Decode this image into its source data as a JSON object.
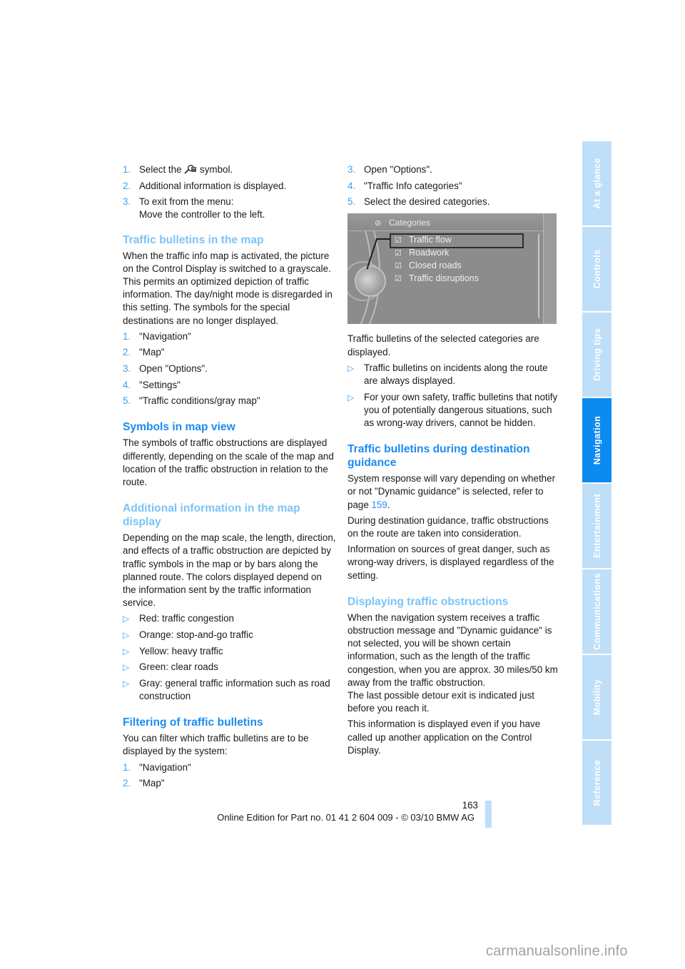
{
  "left_column": {
    "intro_steps": [
      {
        "num": "1.",
        "text_before": "Select the",
        "icon": "map-info-symbol-icon",
        "text_after": "symbol."
      },
      {
        "num": "2.",
        "text": "Additional information is displayed."
      },
      {
        "num": "3.",
        "text": "To exit from the menu:",
        "text2": "Move the controller to the left."
      }
    ],
    "section_traffic_map": {
      "heading": "Traffic bulletins in the map",
      "body": "When the traffic info map is activated, the picture on the Control Display is switched to a grayscale. This permits an optimized depiction of traffic information. The day/night mode is disregarded in this setting. The symbols for the special destinations are no longer displayed.",
      "steps": [
        {
          "num": "1.",
          "text": "\"Navigation\""
        },
        {
          "num": "2.",
          "text": "\"Map\""
        },
        {
          "num": "3.",
          "text": "Open \"Options\"."
        },
        {
          "num": "4.",
          "text": "\"Settings\""
        },
        {
          "num": "5.",
          "text": "\"Traffic conditions/gray map\""
        }
      ]
    },
    "section_symbols": {
      "heading": "Symbols in map view",
      "body": "The symbols of traffic obstructions are displayed differently, depending on the scale of the map and location of the traffic obstruction in relation to the route."
    },
    "section_additional": {
      "heading": "Additional information in the map display",
      "body": "Depending on the map scale, the length, direction, and effects of a traffic obstruction are depicted by traffic symbols in the map or by bars along the planned route. The colors displayed depend on the information sent by the traffic information service.",
      "bullets": [
        "Red: traffic congestion",
        "Orange: stop-and-go traffic",
        "Yellow: heavy traffic",
        "Green: clear roads",
        "Gray: general traffic information such as road construction"
      ],
      "bullet_marker": "▷"
    },
    "section_filtering": {
      "heading": "Filtering of traffic bulletins",
      "body": "You can filter which traffic bulletins are to be displayed by the system:",
      "steps": [
        {
          "num": "1.",
          "text": "\"Navigation\""
        },
        {
          "num": "2.",
          "text": "\"Map\""
        }
      ]
    }
  },
  "right_column": {
    "steps": [
      {
        "num": "3.",
        "text": "Open \"Options\"."
      },
      {
        "num": "4.",
        "text": "\"Traffic Info categories\""
      },
      {
        "num": "5.",
        "text": "Select the desired categories."
      }
    ],
    "screen": {
      "title": "Categories",
      "items": [
        {
          "label": "Traffic flow",
          "checked": true,
          "selected": true
        },
        {
          "label": "Roadwork",
          "checked": true,
          "selected": false
        },
        {
          "label": "Closed roads",
          "checked": true,
          "selected": false
        },
        {
          "label": "Traffic disruptions",
          "checked": true,
          "selected": false
        }
      ],
      "check_glyph": "☑"
    },
    "after_screen": "Traffic bulletins of the selected categories are displayed.",
    "bullets": [
      "Traffic bulletins on incidents along the route are always displayed.",
      "For your own safety, traffic bulletins that notify you of potentially dangerous situations, such as wrong-way drivers, cannot be hidden."
    ],
    "bullet_marker": "▷",
    "section_guidance": {
      "heading": "Traffic bulletins during destination guidance",
      "p1_before": "System response will vary depending on whether or not \"Dynamic guidance\" is selected, refer to page",
      "p1_link": "159",
      "p1_after": ".",
      "p2": "During destination guidance, traffic obstructions on the route are taken into consideration.",
      "p3": "Information on sources of great danger, such as wrong-way drivers, is displayed regardless of the setting."
    },
    "section_displaying": {
      "heading": "Displaying traffic obstructions",
      "p1": "When the navigation system receives a traffic obstruction message and \"Dynamic guidance\" is not selected, you will be shown certain information, such as the length of the traffic congestion, when you are approx. 30 miles/50 km away from the traffic obstruction.",
      "p1b": "The last possible detour exit is indicated just before you reach it.",
      "p2": "This information is displayed even if you have called up another application on the Control Display."
    }
  },
  "sidebar": {
    "tabs": [
      {
        "label": "At a glance",
        "active": false
      },
      {
        "label": "Controls",
        "active": false
      },
      {
        "label": "Driving tips",
        "active": false
      },
      {
        "label": "Navigation",
        "active": true
      },
      {
        "label": "Entertainment",
        "active": false
      },
      {
        "label": "Communications",
        "active": false
      },
      {
        "label": "Mobility",
        "active": false
      },
      {
        "label": "Reference",
        "active": false
      }
    ],
    "active_color": "#0b8af0",
    "inactive_color": "#bfdff9"
  },
  "footer": {
    "page_number": "163",
    "edition": "Online Edition for Part no. 01 41 2 604 009 - © 03/10 BMW AG"
  },
  "watermark": "carmanualsonline.info"
}
